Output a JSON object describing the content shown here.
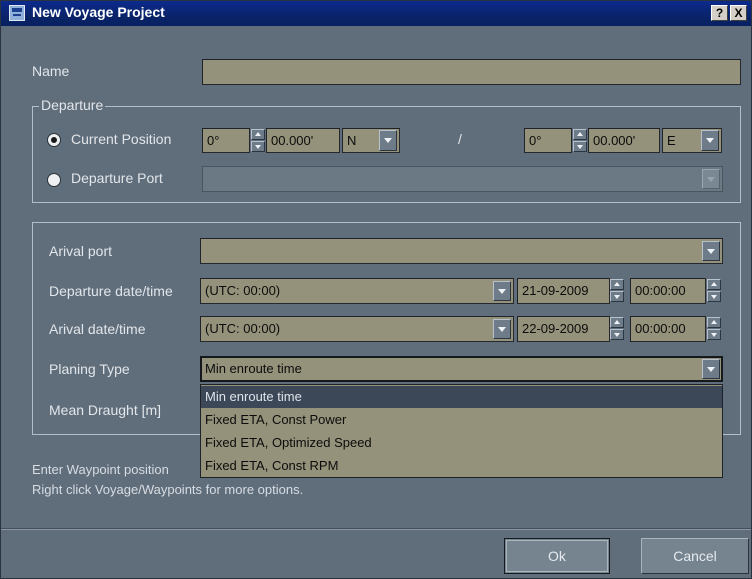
{
  "window": {
    "title": "New Voyage Project",
    "help_label": "?",
    "close_label": "X"
  },
  "name": {
    "label": "Name",
    "value": ""
  },
  "departure": {
    "group_label": "Departure",
    "current_position_label": "Current Position",
    "current_position_selected": true,
    "lat_deg": "0°",
    "lat_min": "00.000'",
    "lat_hemisphere": "N",
    "separator": "/",
    "lon_deg": "0°",
    "lon_min": "00.000'",
    "lon_hemisphere": "E",
    "departure_port_label": "Departure Port",
    "departure_port_value": ""
  },
  "voyage": {
    "arrival_port_label": "Arival port",
    "arrival_port_value": "",
    "departure_dt_label": "Departure date/time",
    "departure_tz": "(UTC:  00:00)",
    "departure_date": "21-09-2009",
    "departure_time": "00:00:00",
    "arrival_dt_label": "Arival date/time",
    "arrival_tz": "(UTC:  00:00)",
    "arrival_date": "22-09-2009",
    "arrival_time": "00:00:00",
    "planning_type_label": "Planing Type",
    "planning_type_value": "Min enroute time",
    "planning_options": [
      "Min enroute time",
      "Fixed ETA, Const Power",
      "Fixed ETA, Optimized Speed",
      "Fixed ETA, Const RPM"
    ],
    "mean_draught_label": "Mean Draught [m]"
  },
  "hints": {
    "line1": "Enter Waypoint position",
    "line2": "Right click Voyage/Waypoints for more options."
  },
  "buttons": {
    "ok": "Ok",
    "cancel": "Cancel"
  }
}
